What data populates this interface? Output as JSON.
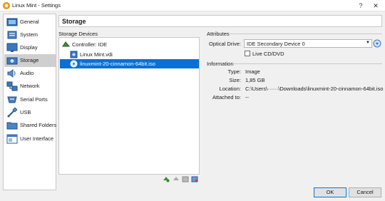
{
  "window": {
    "title": "Linux Mint - Settings",
    "help_label": "?",
    "close_label": "✕"
  },
  "sidebar": {
    "items": [
      {
        "label": "General",
        "icon": "general-icon"
      },
      {
        "label": "System",
        "icon": "system-icon"
      },
      {
        "label": "Display",
        "icon": "display-icon"
      },
      {
        "label": "Storage",
        "icon": "storage-icon",
        "selected": true
      },
      {
        "label": "Audio",
        "icon": "audio-icon"
      },
      {
        "label": "Network",
        "icon": "network-icon"
      },
      {
        "label": "Serial Ports",
        "icon": "serial-ports-icon"
      },
      {
        "label": "USB",
        "icon": "usb-icon"
      },
      {
        "label": "Shared Folders",
        "icon": "shared-folders-icon"
      },
      {
        "label": "User Interface",
        "icon": "user-interface-icon"
      }
    ]
  },
  "page": {
    "title": "Storage"
  },
  "storage_devices": {
    "heading": "Storage Devices",
    "controller": "Controller: IDE",
    "disk": "Linux Mint.vdi",
    "optical": "linuxmint-20-cinnamon-64bit.iso"
  },
  "attributes": {
    "heading": "Attributes",
    "optical_drive_label": "Optical Drive:",
    "optical_drive_value": "IDE Secondary Device 0",
    "live_cd_label": "Live CD/DVD"
  },
  "information": {
    "heading": "Information",
    "type_label": "Type:",
    "type_value": "Image",
    "size_label": "Size:",
    "size_value": "1,85 GB",
    "location_label": "Location:",
    "location_value": "C:\\Users\\······\\Downloads\\linuxmint-20-cinnamon-64bit.iso",
    "attached_label": "Attached to:",
    "attached_value": "--"
  },
  "buttons": {
    "ok": "OK",
    "cancel": "Cancel"
  },
  "colors": {
    "selection": "#0a6fd6",
    "sidebar_selected": "#cfcfcf"
  }
}
